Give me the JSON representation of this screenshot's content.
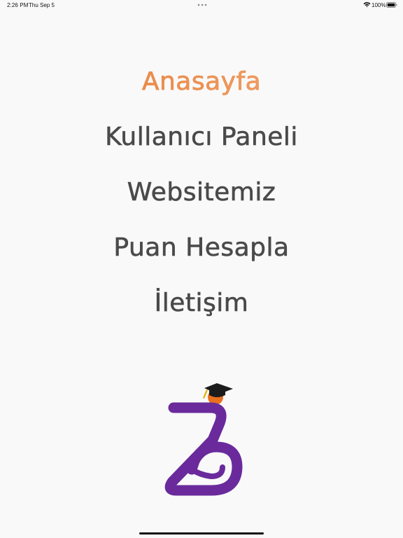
{
  "status_bar": {
    "time": "2:26 PM",
    "date": "Thu Sep 5",
    "battery_percent": "100%",
    "battery_level": 1.0,
    "wifi_icon": "wifi-icon",
    "battery_icon": "battery-icon"
  },
  "menu": {
    "items": [
      {
        "label": "Anasayfa",
        "active": true
      },
      {
        "label": "Kullanıcı Paneli",
        "active": false
      },
      {
        "label": "Websitemiz",
        "active": false
      },
      {
        "label": "Puan Hesapla",
        "active": false
      },
      {
        "label": "İletişim",
        "active": false
      }
    ]
  },
  "logo": {
    "icon": "graduation-logo-icon",
    "colors": {
      "purple": "#6a2a9c",
      "orange": "#e8701f",
      "cap": "#1c1c1c"
    }
  },
  "colors": {
    "background": "#f9f9f9",
    "menu_text": "#4a4a4a",
    "active_start": "#e6782f",
    "active_end": "#f2b184"
  }
}
